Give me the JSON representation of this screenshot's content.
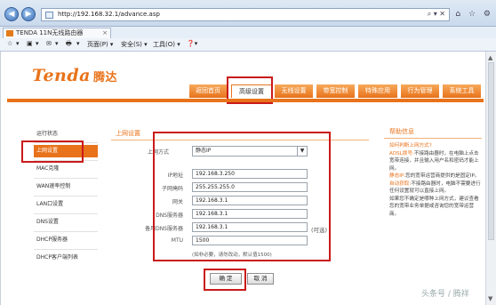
{
  "browser": {
    "url": "http://192.168.32.1/advance.asp",
    "tab_title": "TENDA 11N无线路由器",
    "address_tools": "⌕ ▾ ✕",
    "window_icons": [
      "⌂",
      "☆",
      "⚙"
    ],
    "commands": [
      "☆",
      "▾",
      "▣",
      "▾",
      "✉",
      "▾",
      "🖶",
      "▾",
      "页面(P) ▾",
      "安全(S) ▾",
      "工具(O) ▾",
      "❓▾"
    ]
  },
  "brand": {
    "logo": "Tenda",
    "logo_cn": "腾达"
  },
  "topnav": {
    "items": [
      "返回首页",
      "高级设置",
      "无线设置",
      "带宽控制",
      "特殊应用",
      "行为管理",
      "系统工具"
    ],
    "active_index": 1
  },
  "sidebar": {
    "items": [
      "运行状态",
      "上网设置",
      "MAC克隆",
      "WAN速率控制",
      "LAN口设置",
      "DNS设置",
      "DHCP服务器",
      "DHCP客户端列表"
    ],
    "active_index": 1
  },
  "main": {
    "title": "上网设置",
    "connection_type_label": "上网方式",
    "connection_type_value": "静态IP",
    "fields": [
      {
        "label": "IP地址",
        "value": "192.168.3.250"
      },
      {
        "label": "子网掩码",
        "value": "255.255.255.0"
      },
      {
        "label": "网关",
        "value": "192.168.3.1"
      },
      {
        "label": "DNS服务器",
        "value": "192.168.3.1"
      },
      {
        "label": "备用DNS服务器",
        "value": "192.168.3.1"
      },
      {
        "label": "MTU",
        "value": "1500"
      }
    ],
    "optional_note": "(可选)",
    "mtu_note": "(如非必要，请勿改动，默认值1500)",
    "ok_button": "确 定",
    "cancel_button": "取 消"
  },
  "help": {
    "title": "帮助信息",
    "heading": "如何判断上网方式?",
    "paragraphs": [
      {
        "key": "ADSL拨号:",
        "text": "不接路由器时，在电脑上点击宽带连接，并且输入用户名和密码才能上网。"
      },
      {
        "key": "静态IP:",
        "text": "您的宽带运营商提供的是固定IP。"
      },
      {
        "key": "自动获取:",
        "text": "不接路由器时，电脑不需要进行任何设置就可以直接上网。"
      },
      {
        "key": "",
        "text": "如果您不确定是哪种上网方式，建议查看您的宽带业务单据或咨询您的宽带运营商。"
      }
    ]
  },
  "watermark": "头条号 / 腾祥"
}
